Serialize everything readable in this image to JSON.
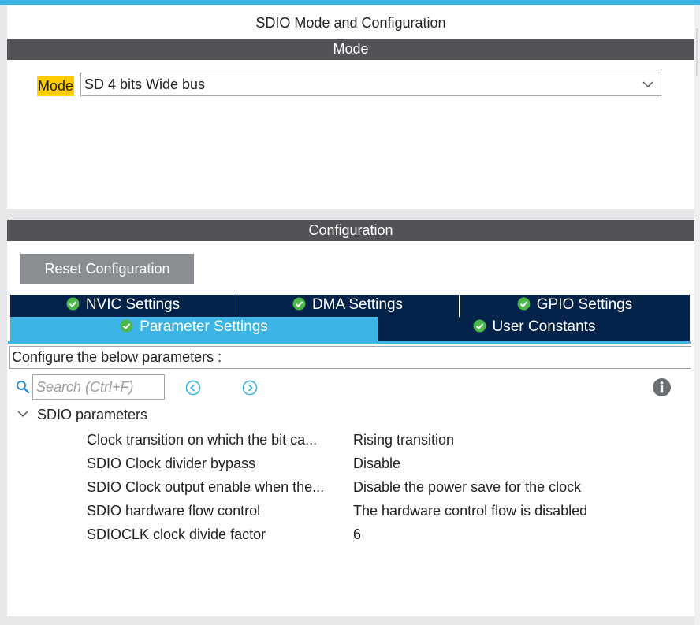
{
  "window": {
    "title": "SDIO Mode and Configuration"
  },
  "mode_section": {
    "header": "Mode",
    "mode_label": "Mode",
    "mode_value": "SD 4 bits Wide bus"
  },
  "config_section": {
    "header": "Configuration",
    "reset_label": "Reset Configuration",
    "tabs_row1": [
      {
        "label": "NVIC Settings",
        "status_icon": "check-circle-icon"
      },
      {
        "label": "DMA Settings",
        "status_icon": "check-circle-icon"
      },
      {
        "label": "GPIO Settings",
        "status_icon": "check-circle-icon"
      }
    ],
    "tabs_row2": [
      {
        "label": "Parameter Settings",
        "status_icon": "check-circle-icon",
        "active": true
      },
      {
        "label": "User Constants",
        "status_icon": "check-circle-icon",
        "active": false
      }
    ],
    "info_text": "Configure the below parameters :",
    "search": {
      "placeholder": "Search (Ctrl+F)",
      "value": ""
    },
    "group": {
      "label": "SDIO parameters",
      "expanded": true,
      "rows": [
        {
          "name": "Clock transition on which the bit ca...",
          "value": "Rising transition"
        },
        {
          "name": "SDIO Clock divider bypass",
          "value": "Disable"
        },
        {
          "name": "SDIO Clock output enable when the...",
          "value": "Disable the power save for the clock"
        },
        {
          "name": "SDIO hardware flow control",
          "value": "The hardware control flow is disabled"
        },
        {
          "name": "SDIOCLK clock divide factor",
          "value": "6"
        }
      ]
    }
  },
  "colors": {
    "accent": "#3cb4e6",
    "header_bg": "#515356",
    "tab_bg": "#03234b",
    "highlight": "#ffcc00",
    "reset_button_bg": "#8a8d91",
    "check_green": "#4cb849"
  }
}
